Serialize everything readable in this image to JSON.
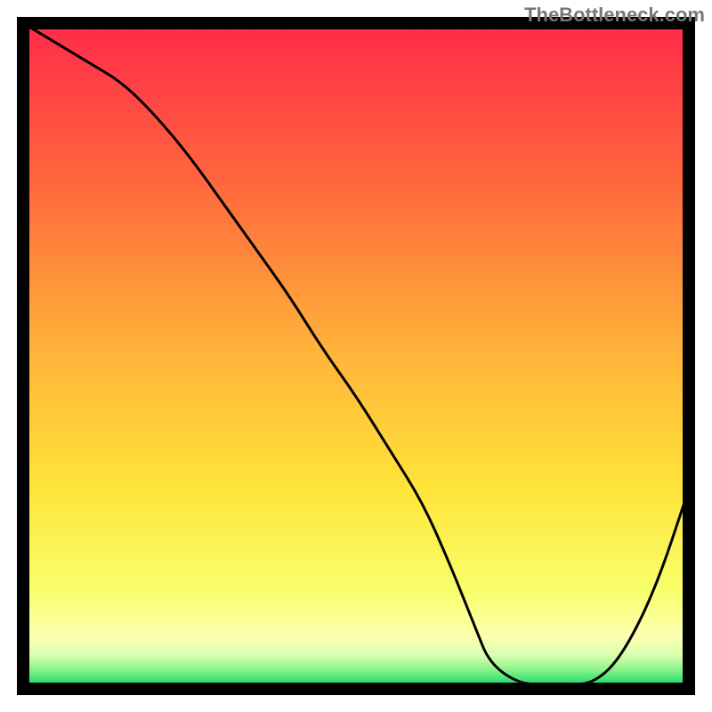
{
  "watermark": "TheBottleneck.com",
  "chart_data": {
    "type": "line",
    "title": "",
    "xlabel": "",
    "ylabel": "",
    "xlim": [
      0,
      100
    ],
    "ylim": [
      0,
      100
    ],
    "x": [
      0,
      5,
      10,
      15,
      20,
      25,
      30,
      35,
      40,
      45,
      50,
      55,
      60,
      64,
      68,
      70,
      74,
      78,
      82,
      86,
      90,
      95,
      100
    ],
    "values": [
      100,
      97,
      94,
      91,
      86,
      80,
      73,
      66,
      59,
      51,
      44,
      36,
      28,
      19,
      9,
      4,
      1,
      0.5,
      0.5,
      1,
      5,
      15,
      30
    ],
    "curve_note": "Two-segment curve: mild descent from x=0 to ~x=20, steeper descent to ~x=70 bottoming near y=0 with a flat plateau ~x=74-82, then rising sharply toward x=100.",
    "marker": {
      "x_start": 74,
      "x_end": 82,
      "y": 0.5,
      "color": "#d96a5c",
      "note": "small dashed/segmented horizontal mark at valley bottom"
    },
    "background_gradient_stops": [
      {
        "offset": 0.0,
        "color": "#ff2a4a"
      },
      {
        "offset": 0.25,
        "color": "#ff6a3d"
      },
      {
        "offset": 0.5,
        "color": "#ffb53a"
      },
      {
        "offset": 0.7,
        "color": "#ffe43a"
      },
      {
        "offset": 0.85,
        "color": "#f8ff6a"
      },
      {
        "offset": 0.92,
        "color": "#fdffb0"
      },
      {
        "offset": 0.95,
        "color": "#d8ffb0"
      },
      {
        "offset": 0.97,
        "color": "#8ff58a"
      },
      {
        "offset": 1.0,
        "color": "#00d26a"
      }
    ],
    "frame_color": "#000000",
    "frame_inset": 26,
    "frame_size": 748
  }
}
